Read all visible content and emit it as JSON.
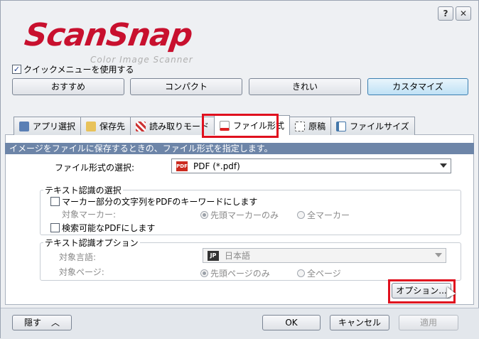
{
  "window": {
    "help_btn": "?",
    "close_btn": "✕"
  },
  "logo": {
    "title": "ScanSnap",
    "subtitle": "Color Image Scanner"
  },
  "quick_menu": {
    "label": "クイックメニューを使用する",
    "checked": true
  },
  "presets": [
    {
      "label": "おすすめ"
    },
    {
      "label": "コンパクト"
    },
    {
      "label": "きれい"
    },
    {
      "label": "カスタマイズ"
    }
  ],
  "tabs": [
    {
      "label": "アプリ選択",
      "icon": "app-icon"
    },
    {
      "label": "保存先",
      "icon": "folder-icon"
    },
    {
      "label": "読み取りモード",
      "icon": "scan-mode-icon"
    },
    {
      "label": "ファイル形式",
      "icon": "file-icon"
    },
    {
      "label": "原稿",
      "icon": "paper-icon"
    },
    {
      "label": "ファイルサイズ",
      "icon": "file-size-icon"
    }
  ],
  "description": "イメージをファイルに保存するときの、ファイル形式を指定します。",
  "file_format": {
    "label": "ファイル形式の選択:",
    "value": "PDF (*.pdf)",
    "icon_text": "PDF"
  },
  "ocr": {
    "group_title": "テキスト認識の選択",
    "marker_checkbox": "マーカー部分の文字列をPDFのキーワードにします",
    "target_marker_label": "対象マーカー:",
    "marker_first": "先頭マーカーのみ",
    "marker_all": "全マーカー",
    "searchable_checkbox": "検索可能なPDFにします"
  },
  "ocr_options": {
    "group_title": "テキスト認識オプション",
    "language_label": "対象言語:",
    "language_value": "日本語",
    "language_icon": "JP",
    "pages_label": "対象ページ:",
    "page_first": "先頭ページのみ",
    "page_all": "全ページ"
  },
  "option_button": "オプション...",
  "bottom": {
    "hide": "隠す",
    "hide_chevron": "︿",
    "ok": "OK",
    "cancel": "キャンセル",
    "apply": "適用"
  },
  "colors": {
    "brand_red": "#c8102e",
    "highlight": "#e0101e",
    "desc_bar": "#6d85a8"
  }
}
